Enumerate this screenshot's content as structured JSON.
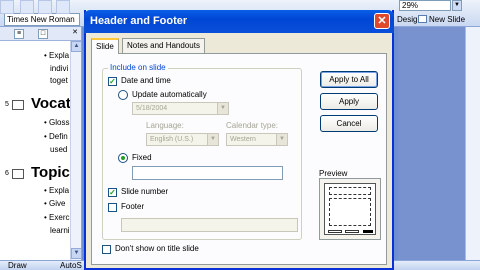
{
  "app": {
    "font_box": "Times New Roman",
    "zoom": "29%",
    "toolbar_right": [
      "Design",
      "New Slide"
    ],
    "outline": {
      "bullets_slide4": [
        "Expla",
        "indivi",
        "toget"
      ],
      "slide5": {
        "number": "5",
        "title": "Vocat",
        "bullets": [
          "Gloss",
          "Defin",
          "used"
        ]
      },
      "slide6": {
        "number": "6",
        "title": "Topic",
        "bullets": [
          "Expla",
          "Give",
          "Exerc",
          "learni"
        ]
      }
    },
    "draw_bar": {
      "draw": "Draw",
      "autoshapes": "AutoS"
    }
  },
  "dialog": {
    "title": "Header and Footer",
    "close_glyph": "✕",
    "tabs": [
      "Slide",
      "Notes and Handouts"
    ],
    "group_title": "Include on slide",
    "date_and_time": "Date and time",
    "update_automatically": "Update automatically",
    "date_value": "5/18/2004",
    "language_label": "Language:",
    "calendar_label": "Calendar type:",
    "language_value": "English (U.S.)",
    "calendar_value": "Western",
    "fixed": "Fixed",
    "fixed_value": "",
    "slide_number": "Slide number",
    "footer": "Footer",
    "footer_value": "",
    "dont_show_title": "Don't show on title slide",
    "buttons": {
      "apply_all": "Apply to All",
      "apply": "Apply",
      "cancel": "Cancel"
    },
    "preview_label": "Preview",
    "checks": {
      "date_and_time": true,
      "slide_number": true,
      "footer": false,
      "dont_show_title": false
    },
    "radio_selected": "fixed"
  },
  "colors": {
    "titlebar": "#0046d5",
    "dialog_face": "#ece9d8",
    "check_green": "#21a121",
    "group_label_blue": "#0046d5"
  }
}
